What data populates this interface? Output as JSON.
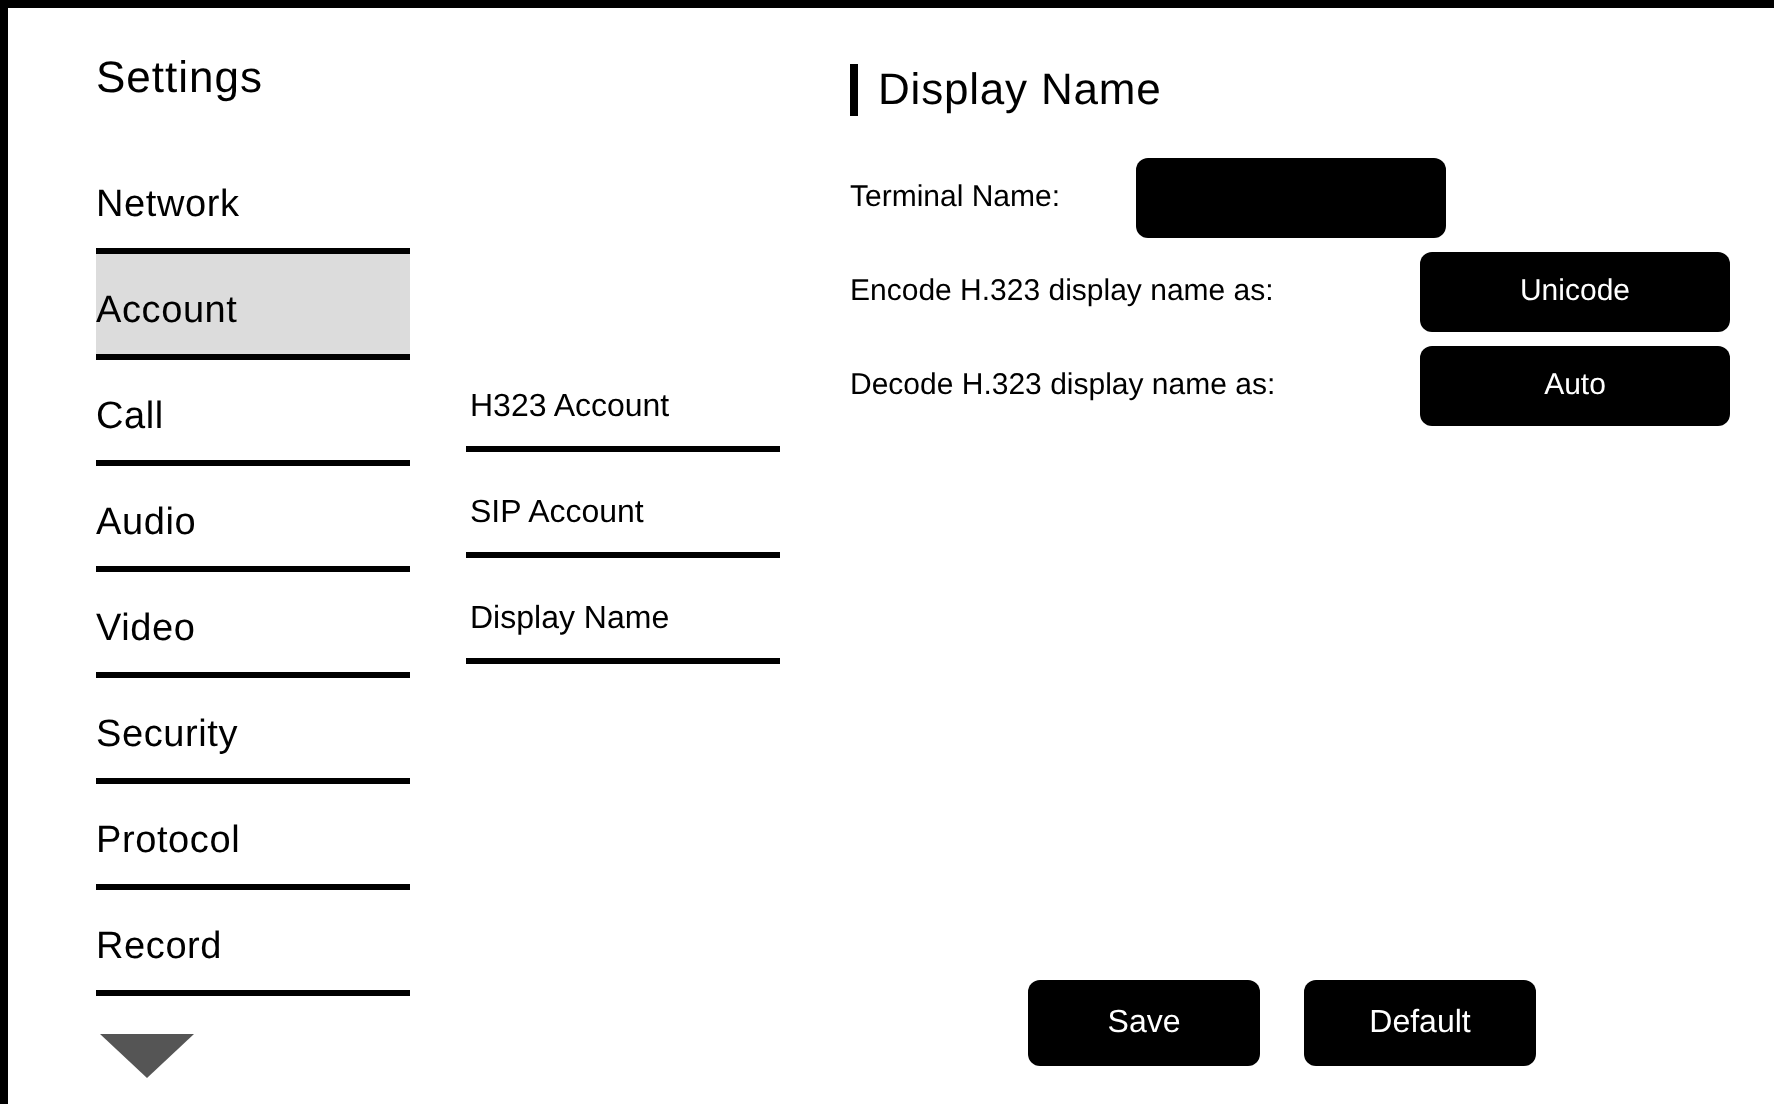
{
  "sidebar": {
    "title": "Settings",
    "items": [
      {
        "label": "Network",
        "selected": false
      },
      {
        "label": "Account",
        "selected": true
      },
      {
        "label": "Call",
        "selected": false
      },
      {
        "label": "Audio",
        "selected": false
      },
      {
        "label": "Video",
        "selected": false
      },
      {
        "label": "Security",
        "selected": false
      },
      {
        "label": "Protocol",
        "selected": false
      },
      {
        "label": "Record",
        "selected": false
      }
    ]
  },
  "submenu": {
    "items": [
      "H323 Account",
      "SIP Account",
      "Display Name"
    ]
  },
  "panel": {
    "title": "Display Name",
    "fields": [
      {
        "kind": "text",
        "label": "Terminal Name:"
      },
      {
        "kind": "dropdown",
        "label": "Encode H.323 display name as:",
        "value": "Unicode"
      },
      {
        "kind": "dropdown",
        "label": "Decode H.323 display name as:",
        "value": "Auto"
      }
    ]
  },
  "buttons": [
    "Save",
    "Default"
  ]
}
